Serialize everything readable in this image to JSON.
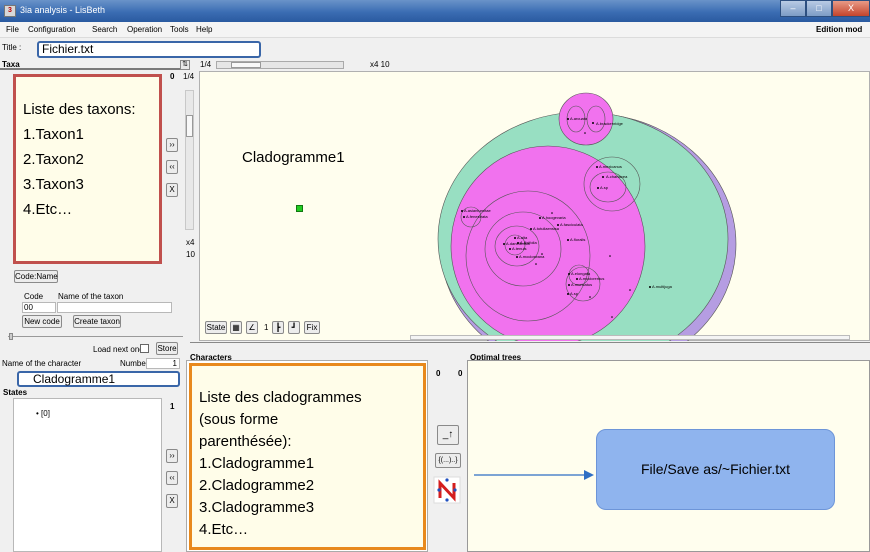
{
  "window": {
    "title": "3ia analysis - LisBeth",
    "minimize": "–",
    "maximize": "□",
    "close": "X"
  },
  "menu": [
    "File",
    "Configuration",
    "Search",
    "Operation",
    "Tools",
    "Help"
  ],
  "mode": "Edition mod",
  "title_label": "Title :",
  "title_value": "Fichier.txt",
  "taxa": {
    "header": "Taxa",
    "count": "0",
    "callout_lines": [
      "Liste des taxons:",
      "1.Taxon1",
      "2.Taxon2",
      "3.Taxon3",
      "4.Etc…"
    ],
    "btn_right": "››",
    "btn_left": "‹‹",
    "btn_x": "X",
    "codename_btn": "Code:Name",
    "code_label": "Code",
    "name_label": "Name of the taxon",
    "code_value": "00",
    "new_code_btn": "New code",
    "create_taxon_btn": "Create taxon",
    "load_next_label": "Load next one",
    "store_btn": "Store"
  },
  "zoom": {
    "top_label": "1/4",
    "right_label": "x4 10",
    "side_top": "1/4",
    "side_bottom_1": "x4",
    "side_bottom_2": "10"
  },
  "canvas": {
    "label": "Cladogramme1",
    "state_btn": "State",
    "tool_one": "1",
    "fix_btn": "Fix",
    "node_labels": [
      "A.arcuata",
      "A.brackenridge",
      "A.mexicanus",
      "A.chartacea",
      "A.sp",
      "A.asianturnitae",
      "A.fenestrata",
      "A.hoogevaria",
      "A.fasciculata",
      "A.tutuilaensis",
      "A.alta",
      "A.ilicifolia",
      "A.floralis",
      "A.daneilensis",
      "A.tenuis",
      "A.mocloseana",
      "A.elongata",
      "A.mucicrentus",
      "A.muricatus",
      "A.multijuga",
      "A.sp"
    ]
  },
  "character": {
    "name_label": "Name of the character",
    "number_label": "Number",
    "number_value": "1",
    "name_value": "Cladogramme1",
    "states_header": "States",
    "states_count": "1",
    "state_item": "• [0]",
    "btn_right": "››",
    "btn_left": "‹‹",
    "btn_x": "X"
  },
  "characters": {
    "header": "Characters",
    "count_a": "0",
    "count_b": "0",
    "callout_lines": [
      "Liste des cladogrammes",
      "(sous forme",
      "parenthésée):",
      "1.Cladogramme1",
      "2.Cladogramme2",
      "3.Cladogramme3",
      "4.Etc…"
    ],
    "export_btn": "_↑",
    "paren_btn": "{(...)..}"
  },
  "optimal": {
    "header": "Optimal trees",
    "callout": "File/Save as/~Fichier.txt"
  }
}
